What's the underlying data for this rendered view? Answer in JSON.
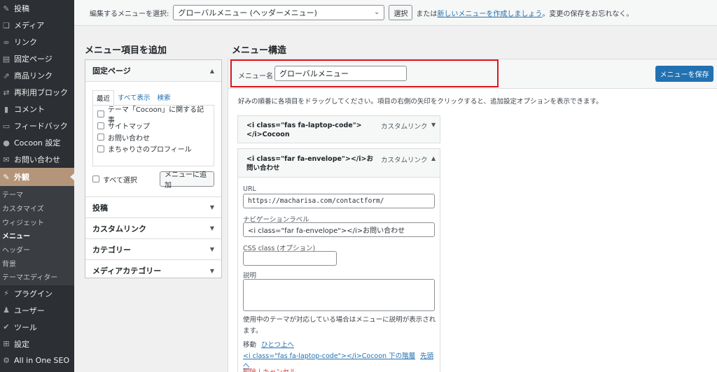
{
  "sidebar": {
    "items": [
      {
        "icon": "pin-icon",
        "glyph": "✎",
        "label": "投稿"
      },
      {
        "icon": "media-icon",
        "glyph": "❏",
        "label": "メディア"
      },
      {
        "icon": "link-icon",
        "glyph": "∞",
        "label": "リンク"
      },
      {
        "icon": "page-icon",
        "glyph": "▤",
        "label": "固定ページ"
      },
      {
        "icon": "product-link-icon",
        "glyph": "⇗",
        "label": "商品リンク"
      },
      {
        "icon": "reusable-block-icon",
        "glyph": "⇄",
        "label": "再利用ブロック"
      },
      {
        "icon": "comment-icon",
        "glyph": "▮",
        "label": "コメント"
      },
      {
        "icon": "feedback-icon",
        "glyph": "▭",
        "label": "フィードバック"
      },
      {
        "icon": "cocoon-icon",
        "glyph": "●",
        "label": "Cocoon 設定"
      },
      {
        "icon": "mail-icon",
        "glyph": "✉",
        "label": "お問い合わせ"
      },
      {
        "icon": "appearance-icon",
        "glyph": "✎",
        "label": "外観"
      }
    ],
    "submenu": [
      "テーマ",
      "カスタマイズ",
      "ウィジェット",
      "メニュー",
      "ヘッダー",
      "背景",
      "テーマエディター"
    ],
    "bottom": [
      {
        "icon": "plugin-icon",
        "glyph": "⚡",
        "label": "プラグイン"
      },
      {
        "icon": "user-icon",
        "glyph": "♟",
        "label": "ユーザー"
      },
      {
        "icon": "tool-icon",
        "glyph": "✔",
        "label": "ツール"
      },
      {
        "icon": "settings-icon",
        "glyph": "⊞",
        "label": "設定"
      },
      {
        "icon": "seo-icon",
        "glyph": "⚙",
        "label": "All in One SEO"
      }
    ]
  },
  "topbar": {
    "select_label": "編集するメニューを選択:",
    "select_value": "グローバルメニュー (ヘッダーメニュー)",
    "select_button": "選択",
    "text_or": "または",
    "create_link": "新しいメニューを作成しましょう",
    "text_after": "。変更の保存をお忘れなく。"
  },
  "add_panel": {
    "heading": "メニュー項目を追加",
    "open_section": "固定ページ",
    "tabs": [
      "最近",
      "すべて表示",
      "検索"
    ],
    "pages": [
      "テーマ「Cocoon」に関する記事",
      "サイトマップ",
      "お問い合わせ",
      "まちゃりさのプロフィール"
    ],
    "select_all": "すべて選択",
    "add_button": "メニューに追加",
    "sections": [
      "投稿",
      "カスタムリンク",
      "カテゴリー",
      "メディアカテゴリー"
    ]
  },
  "structure": {
    "heading": "メニュー構造",
    "name_label": "メニュー名",
    "name_value": "グローバルメニュー",
    "save_button": "メニューを保存",
    "instructions": "好みの順番に各項目をドラッグしてください。項目の右側の矢印をクリックすると、追加設定オプションを表示できます。",
    "items": [
      {
        "title_l1": "<i class=\"fas fa-laptop-code\">",
        "title_l2": "</i>Cocoon",
        "kind": "カスタムリンク"
      },
      {
        "title_l1": "<i class=\"far fa-envelope\"></i>お",
        "title_l2": "問い合わせ",
        "kind": "カスタムリンク"
      }
    ],
    "settings": {
      "url_label": "URL",
      "url_value": "https://macharisa.com/contactform/",
      "nav_label": "ナビゲーションラベル",
      "nav_value": "<i class=\"far fa-envelope\"></i>お問い合わせ",
      "css_label": "CSS class (オプション)",
      "css_value": "",
      "desc_label": "説明",
      "desc_value": "",
      "note": "使用中のテーマが対応している場合はメニューに説明が表示されます。",
      "move_label": "移動",
      "move_up": "ひとつ上へ",
      "move_under": "<i class=\"fas fa-laptop-code\"></i>Cocoon 下の階層",
      "move_top": "先頭へ",
      "delete": "削除 | キャンセル"
    }
  },
  "colors": {
    "accent": "#2271b1",
    "highlight": "#e0141f",
    "sidebar": "#2c2f33",
    "active": "#b5957a"
  }
}
